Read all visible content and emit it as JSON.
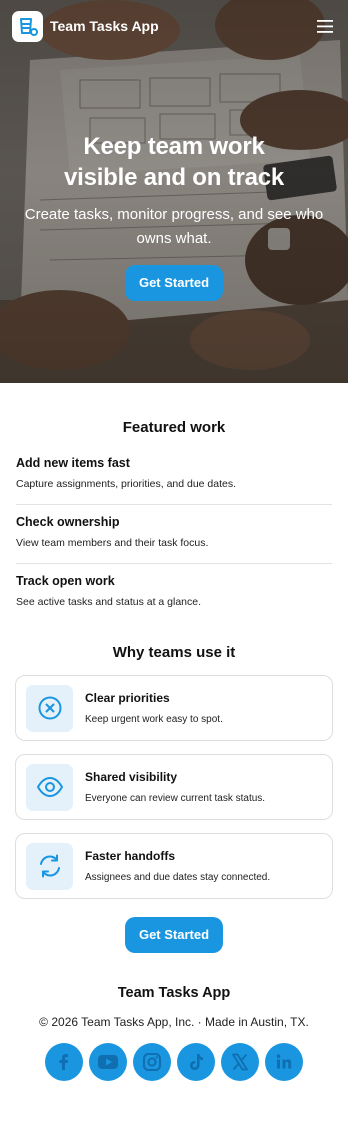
{
  "app": {
    "name": "Team Tasks App"
  },
  "colors": {
    "accent": "#1a96e0",
    "icon_bg": "#e4f1fa",
    "border": "#dedede"
  },
  "header": {
    "menu_icon": "hamburger-menu-icon"
  },
  "hero": {
    "title": "Keep team work visible and on track",
    "subtitle": "Create tasks, monitor progress, and see who owns what.",
    "cta": "Get Started"
  },
  "featured": {
    "title": "Featured work",
    "items": [
      {
        "title": "Add new items fast",
        "desc": "Capture assignments, priorities, and due dates."
      },
      {
        "title": "Check ownership",
        "desc": "View team members and their task focus."
      },
      {
        "title": "Track open work",
        "desc": "See active tasks and status at a glance."
      }
    ]
  },
  "why": {
    "title": "Why teams use it",
    "cards": [
      {
        "icon": "x-circle-icon",
        "title": "Clear priorities",
        "desc": "Keep urgent work easy to spot."
      },
      {
        "icon": "eye-icon",
        "title": "Shared visibility",
        "desc": "Everyone can review current task status."
      },
      {
        "icon": "refresh-icon",
        "title": "Faster handoffs",
        "desc": "Assignees and due dates stay connected."
      }
    ]
  },
  "bottom_cta": "Get Started",
  "footer": {
    "title": "Team Tasks App",
    "copyright": "© 2026 Team Tasks App, Inc. · Made in Austin, TX.",
    "socials": [
      "facebook-icon",
      "youtube-icon",
      "instagram-icon",
      "tiktok-icon",
      "x-icon",
      "linkedin-icon"
    ]
  }
}
